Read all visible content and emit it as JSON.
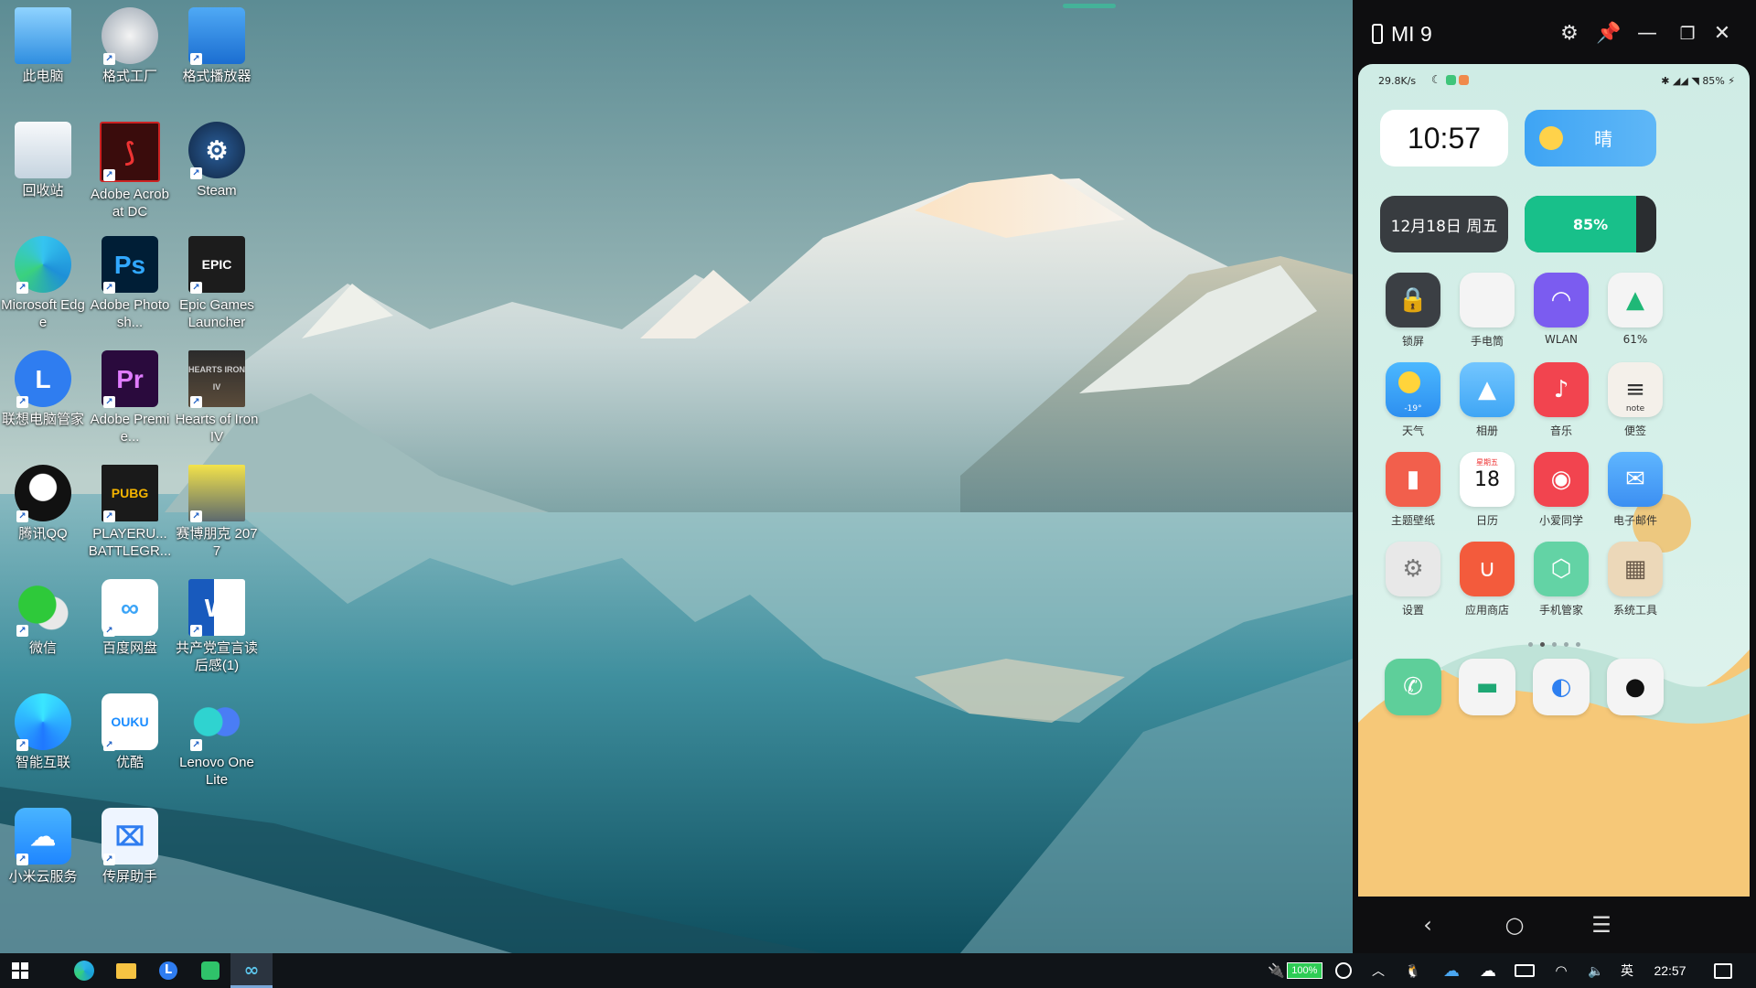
{
  "desktop": {
    "icons": [
      {
        "label": "此电脑",
        "icon": "computer-icon"
      },
      {
        "label": "格式工厂",
        "icon": "format-factory-icon"
      },
      {
        "label": "格式播放器",
        "icon": "format-player-icon"
      },
      {
        "label": "回收站",
        "icon": "recycle-bin-icon"
      },
      {
        "label": "Adobe Acrobat DC",
        "icon": "acrobat-icon"
      },
      {
        "label": "Steam",
        "icon": "steam-icon"
      },
      {
        "label": "Microsoft Edge",
        "icon": "edge-icon"
      },
      {
        "label": "Adobe Photosh...",
        "icon": "photoshop-icon",
        "badge": "Ps"
      },
      {
        "label": "Epic Games Launcher",
        "icon": "epic-games-icon",
        "badge": "EPIC"
      },
      {
        "label": "联想电脑管家",
        "icon": "lenovo-manager-icon",
        "badge": "L"
      },
      {
        "label": "Adobe Premie...",
        "icon": "premiere-icon",
        "badge": "Pr"
      },
      {
        "label": "Hearts of Iron IV",
        "icon": "hearts-of-iron-icon",
        "badge": "HEARTS IRON IV"
      },
      {
        "label": "腾讯QQ",
        "icon": "qq-icon"
      },
      {
        "label": "PLAYERU... BATTLEGR...",
        "icon": "pubg-icon",
        "badge": "PUBG"
      },
      {
        "label": "赛博朋克 2077",
        "icon": "cyberpunk-icon"
      },
      {
        "label": "微信",
        "icon": "wechat-icon"
      },
      {
        "label": "百度网盘",
        "icon": "baidu-netdisk-icon"
      },
      {
        "label": "共产党宣言读后感(1)",
        "icon": "word-doc-icon",
        "badge": "W"
      },
      {
        "label": "智能互联",
        "icon": "smart-connect-icon"
      },
      {
        "label": "优酷",
        "icon": "youku-icon",
        "badge": "OUKU"
      },
      {
        "label": "Lenovo One Lite",
        "icon": "lenovo-one-icon"
      },
      {
        "label": "小米云服务",
        "icon": "mi-cloud-icon"
      },
      {
        "label": "传屏助手",
        "icon": "screen-cast-icon"
      }
    ]
  },
  "phone_window": {
    "title": "MI 9",
    "status": {
      "speed": "29.8K/s",
      "battery": "85"
    },
    "clock": "10:57",
    "weather": "晴",
    "date": "12月18日 周五",
    "battery_widget": {
      "label": "85%",
      "level": 0.85
    },
    "toggles": [
      {
        "label": "锁屏",
        "icon": "lock-icon",
        "color": "#3b3f44"
      },
      {
        "label": "手电筒",
        "icon": "flashlight-icon",
        "color": "#f4f4f4"
      },
      {
        "label": "WLAN",
        "icon": "wifi-icon",
        "color": "#7b5cf0"
      },
      {
        "label": "61%",
        "icon": "cleaner-icon",
        "color": "#f4f4f4"
      }
    ],
    "apps_row1": [
      {
        "label": "天气",
        "icon": "weather-icon",
        "sub": "-19°"
      },
      {
        "label": "相册",
        "icon": "gallery-icon"
      },
      {
        "label": "音乐",
        "icon": "music-icon"
      },
      {
        "label": "便签",
        "icon": "notes-icon",
        "sub": "note"
      }
    ],
    "apps_row2": [
      {
        "label": "主题壁纸",
        "icon": "themes-icon"
      },
      {
        "label": "日历",
        "icon": "calendar-icon",
        "day": "18",
        "weekday": "星期五"
      },
      {
        "label": "小爱同学",
        "icon": "xiaoai-icon"
      },
      {
        "label": "电子邮件",
        "icon": "email-icon"
      }
    ],
    "apps_row3": [
      {
        "label": "设置",
        "icon": "settings-icon"
      },
      {
        "label": "应用商店",
        "icon": "app-store-icon"
      },
      {
        "label": "手机管家",
        "icon": "security-icon"
      },
      {
        "label": "系统工具",
        "icon": "system-tools-folder-icon"
      }
    ],
    "dock": [
      {
        "icon": "phone-icon"
      },
      {
        "icon": "messages-icon"
      },
      {
        "icon": "browser-icon"
      },
      {
        "icon": "camera-icon"
      }
    ],
    "page_count": 5,
    "active_page": 1
  },
  "taskbar": {
    "battery_percent": "100%",
    "ime": "英",
    "time": "22:57"
  }
}
